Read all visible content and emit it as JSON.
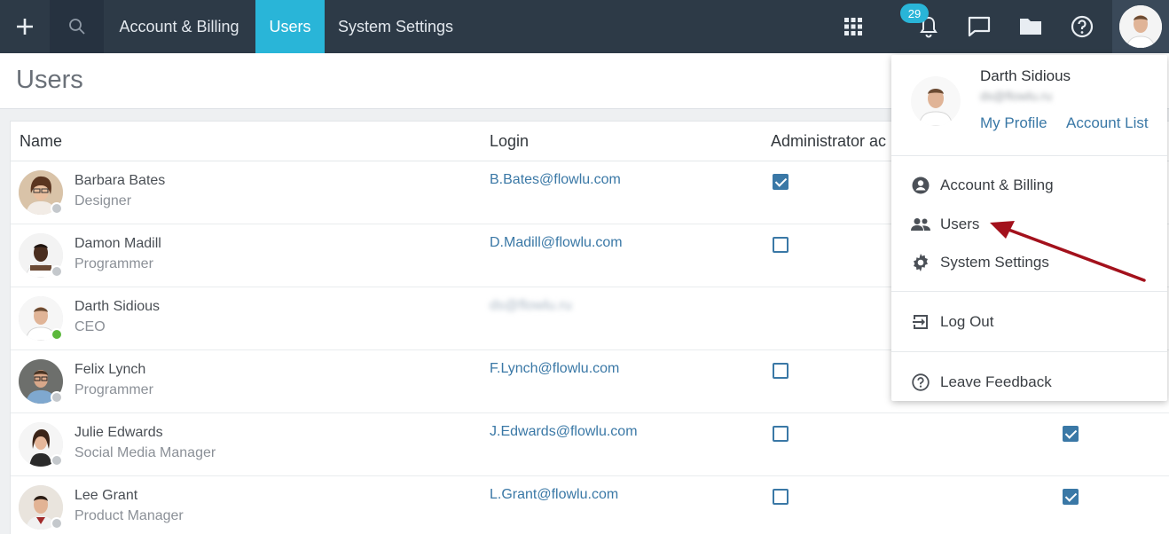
{
  "topbar": {
    "nav": [
      {
        "label": "Account & Billing",
        "active": false
      },
      {
        "label": "Users",
        "active": true
      },
      {
        "label": "System Settings",
        "active": false
      }
    ],
    "notification_count": "29",
    "icons": [
      "plus-icon",
      "search-icon",
      "apps-grid-icon",
      "bell-icon",
      "chat-icon",
      "folder-icon",
      "help-icon"
    ]
  },
  "page": {
    "title": "Users"
  },
  "table": {
    "columns": [
      "Name",
      "Login",
      "Administrator ac"
    ],
    "rows": [
      {
        "name": "Barbara Bates",
        "role": "Designer",
        "login": "B.Bates@flowlu.com",
        "admin": true,
        "col4": null,
        "online": false
      },
      {
        "name": "Damon Madill",
        "role": "Programmer",
        "login": "D.Madill@flowlu.com",
        "admin": false,
        "col4": null,
        "online": false
      },
      {
        "name": "Darth Sidious",
        "role": "CEO",
        "login": "ds@flowlu.ru",
        "admin": null,
        "col4": null,
        "online": true
      },
      {
        "name": "Felix Lynch",
        "role": "Programmer",
        "login": "F.Lynch@flowlu.com",
        "admin": false,
        "col4": null,
        "online": false
      },
      {
        "name": "Julie Edwards",
        "role": "Social Media Manager",
        "login": "J.Edwards@flowlu.com",
        "admin": false,
        "col4": true,
        "online": false
      },
      {
        "name": "Lee Grant",
        "role": "Product Manager",
        "login": "L.Grant@flowlu.com",
        "admin": false,
        "col4": true,
        "online": false
      }
    ]
  },
  "dropdown": {
    "user_name": "Darth Sidious",
    "user_email": "ds@flowlu.ru",
    "my_profile": "My Profile",
    "account_list": "Account List",
    "items": [
      {
        "label": "Account & Billing",
        "icon": "account-circle-icon"
      },
      {
        "label": "Users",
        "icon": "users-icon"
      },
      {
        "label": "System Settings",
        "icon": "gear-icon"
      },
      {
        "label": "Log Out",
        "icon": "logout-icon"
      },
      {
        "label": "Leave Feedback",
        "icon": "feedback-icon"
      }
    ]
  },
  "colors": {
    "topbar_bg": "#2d3a47",
    "accent": "#29b5d8",
    "link": "#3a78a6",
    "annotation_arrow": "#a3111c"
  }
}
